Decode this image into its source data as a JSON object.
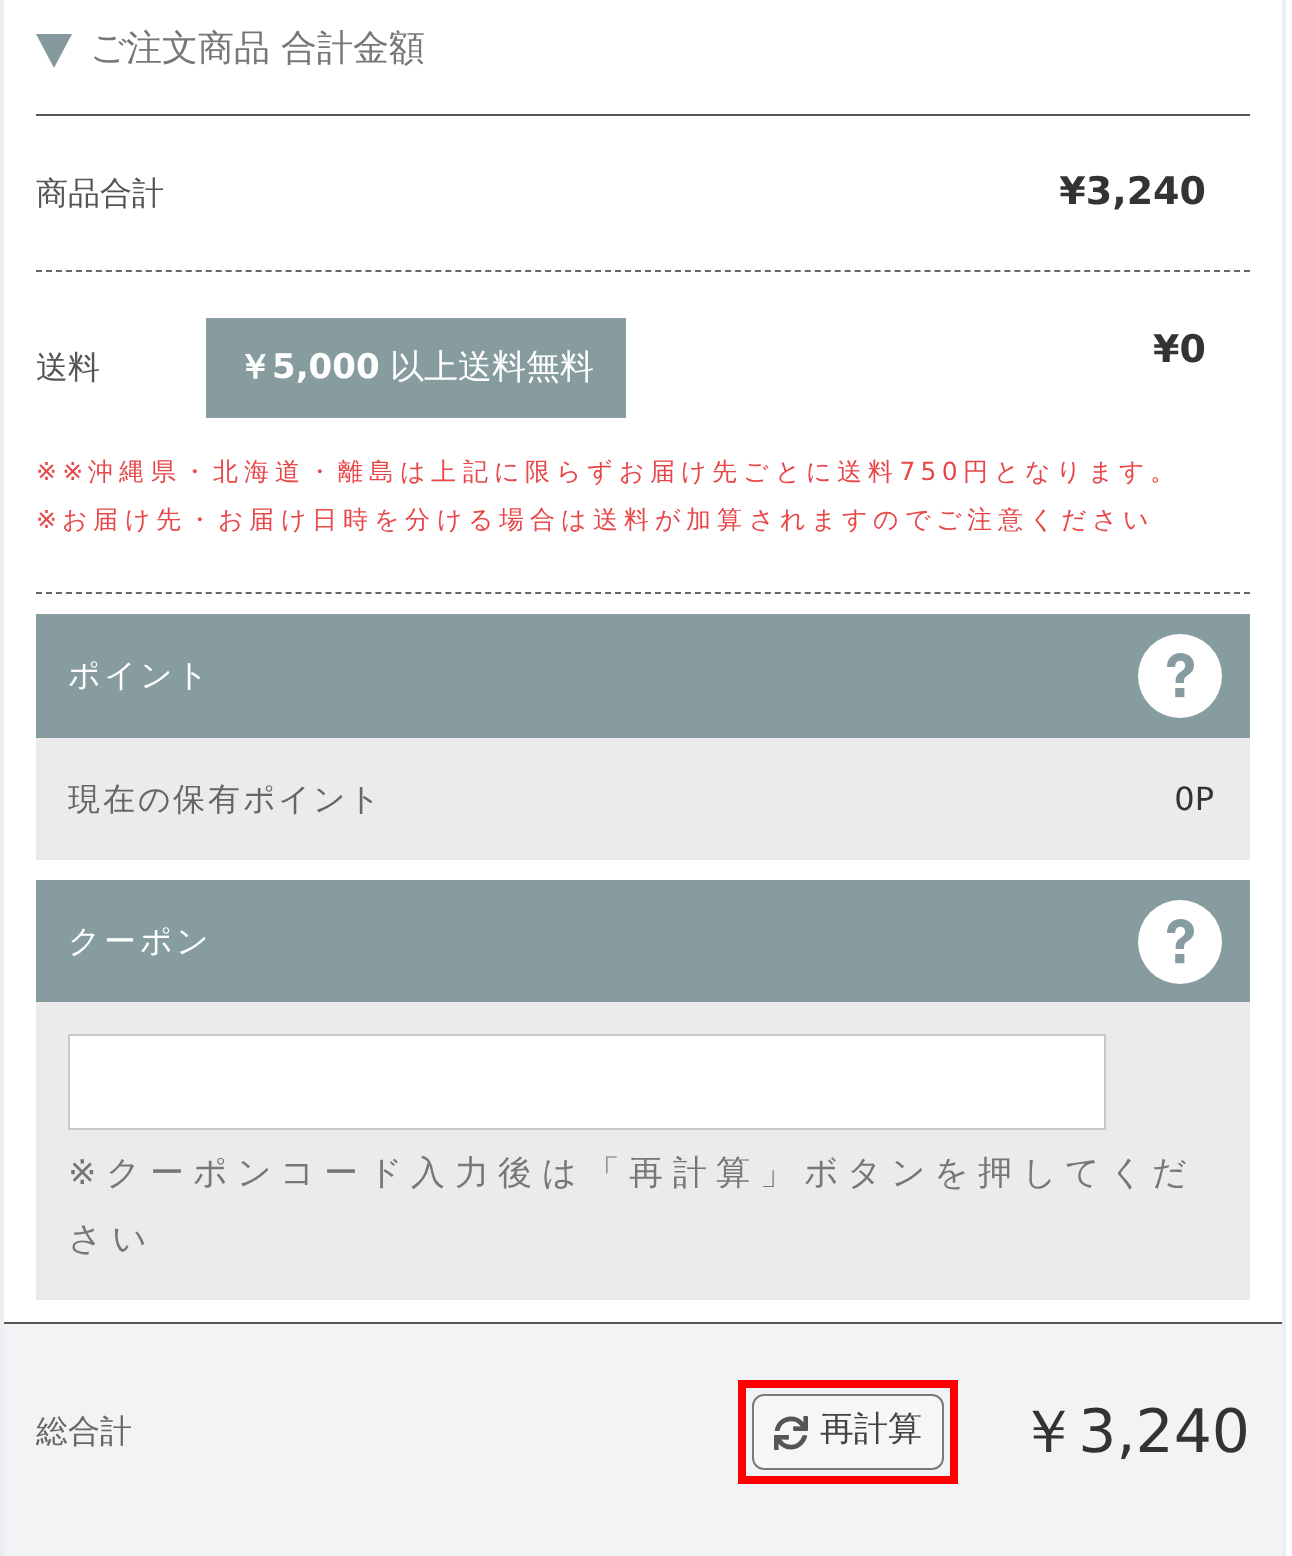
{
  "section_header": {
    "title": "ご注文商品 合計金額",
    "expanded": true
  },
  "subtotal": {
    "label": "商品合計",
    "value": "¥3,240"
  },
  "shipping": {
    "label": "送料",
    "badge": "**￥5,000** 以上送料無料",
    "value": "¥0",
    "notes": [
      "※※沖縄県・北海道・離島は上記に限らずお届け先ごとに送料750円となります。",
      "※お届け先・お届け日時を分ける場合は送料が加算されますのでご注意ください"
    ]
  },
  "points": {
    "title": "ポイント",
    "label": "現在の保有ポイント",
    "value": "0P"
  },
  "coupon": {
    "title": "クーポン",
    "note": "※クーポンコード入力後は「再計算」ボタンを押してください"
  },
  "total": {
    "label": "総合計",
    "recalc_button": {
      "label": "再計算",
      "highlighted": true
    },
    "value": "￥3,240"
  }
}
